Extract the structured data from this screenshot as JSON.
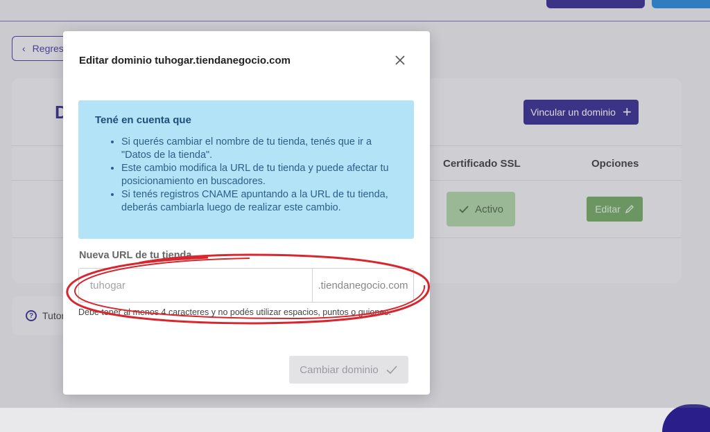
{
  "background": {
    "back_label": "Regresar",
    "section_title": "D",
    "link_domain_label": "Vincular un dominio",
    "table_headers": {
      "ssl": "Certificado SSL",
      "options": "Opciones"
    },
    "ssl_status": "Activo",
    "edit_label": "Editar",
    "tutorial_label": "Tutor"
  },
  "modal": {
    "title": "Editar dominio tuhogar.tiendanegocio.com",
    "info": {
      "title": "Tené en cuenta que",
      "items": [
        "Si querés cambiar el nombre de tu tienda, tenés que ir a \"Datos de la tienda\".",
        "Este cambio modifica la URL de tu tienda y puede afectar tu posicionamiento en buscadores.",
        "Si tenés registros CNAME apuntando a la URL de tu tienda, deberás cambiarla luego de realizar este cambio."
      ]
    },
    "field_label": "Nueva URL de tu tienda",
    "input_placeholder": "tuhogar",
    "domain_suffix": ".tiendanegocio.com",
    "hint": "Debe tener al menos 4 caracteres y no podés utilizar espacios, puntos o guiones.",
    "submit_label": "Cambiar dominio"
  },
  "colors": {
    "brand": "#2a1f8a",
    "info_bg": "#b3e3f7",
    "success": "#6aa35a",
    "annotation": "#d7262e"
  },
  "icons": [
    "chevron-left-icon",
    "plus-icon",
    "check-icon",
    "pencil-icon",
    "help-icon",
    "close-icon"
  ]
}
